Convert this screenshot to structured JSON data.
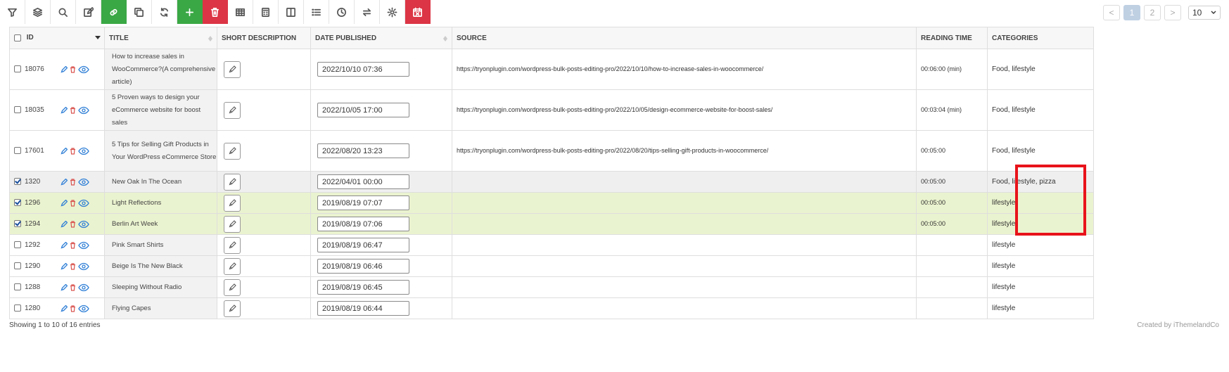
{
  "toolbar": {
    "buttons": [
      {
        "icon": "filter-icon"
      },
      {
        "icon": "layers-icon"
      },
      {
        "icon": "search-icon"
      },
      {
        "icon": "edit-icon"
      },
      {
        "icon": "link-icon",
        "color": "#3aa845"
      },
      {
        "icon": "copy-icon"
      },
      {
        "icon": "refresh-icon"
      },
      {
        "icon": "plus-icon",
        "color": "#3aa845"
      },
      {
        "icon": "trash-icon",
        "color": "#dc3545"
      },
      {
        "icon": "table-icon"
      },
      {
        "icon": "calculator-icon"
      },
      {
        "icon": "columns-icon"
      },
      {
        "icon": "list-icon"
      },
      {
        "icon": "clock-icon"
      },
      {
        "icon": "swap-icon"
      },
      {
        "icon": "gear-icon"
      },
      {
        "icon": "calendar-remove-icon",
        "color": "#dc3545"
      }
    ]
  },
  "pagination": {
    "prev": "<",
    "pages": [
      "1",
      "2"
    ],
    "active": "1",
    "next": ">",
    "per_page": "10"
  },
  "table": {
    "headers": {
      "id": "ID",
      "title": "TITLE",
      "short_description": "SHORT DESCRIPTION",
      "date_published": "DATE PUBLISHED",
      "source": "SOURCE",
      "reading_time": "READING TIME",
      "categories": "CATEGORIES"
    },
    "rows": [
      {
        "id": "18076",
        "checked": false,
        "title": "How to increase sales in WooCommerce?(A comprehensive article)",
        "date": "2022/10/10 07:36",
        "source": "https://tryonplugin.com/wordpress-bulk-posts-editing-pro/2022/10/10/how-to-increase-sales-in-woocommerce/",
        "reading_time": "00:06:00 (min)",
        "categories": "Food, lifestyle"
      },
      {
        "id": "18035",
        "checked": false,
        "title": "5 Proven ways to design your eCommerce website for boost sales",
        "date": "2022/10/05 17:00",
        "source": "https://tryonplugin.com/wordpress-bulk-posts-editing-pro/2022/10/05/design-ecommerce-website-for-boost-sales/",
        "reading_time": "00:03:04 (min)",
        "categories": "Food, lifestyle"
      },
      {
        "id": "17601",
        "checked": false,
        "title": "5 Tips for Selling Gift Products in Your WordPress eCommerce Store",
        "date": "2022/08/20 13:23",
        "source": "https://tryonplugin.com/wordpress-bulk-posts-editing-pro/2022/08/20/tips-selling-gift-products-in-woocommerce/",
        "reading_time": "00:05:00",
        "categories": "Food, lifestyle"
      },
      {
        "id": "1320",
        "checked": true,
        "title": "New Oak In The Ocean",
        "date": "2022/04/01 00:00",
        "source": "",
        "reading_time": "00:05:00",
        "categories": "Food, lifestyle, pizza"
      },
      {
        "id": "1296",
        "checked": true,
        "title": "Light Reflections",
        "date": "2019/08/19 07:07",
        "source": "",
        "reading_time": "00:05:00",
        "categories": "lifestyle"
      },
      {
        "id": "1294",
        "checked": true,
        "title": "Berlin Art Week",
        "date": "2019/08/19 07:06",
        "source": "",
        "reading_time": "00:05:00",
        "categories": "lifestyle"
      },
      {
        "id": "1292",
        "checked": false,
        "title": "Pink Smart Shirts",
        "date": "2019/08/19 06:47",
        "source": "",
        "reading_time": "",
        "categories": "lifestyle"
      },
      {
        "id": "1290",
        "checked": false,
        "title": "Beige Is The New Black",
        "date": "2019/08/19 06:46",
        "source": "",
        "reading_time": "",
        "categories": "lifestyle"
      },
      {
        "id": "1288",
        "checked": false,
        "title": "Sleeping Without Radio",
        "date": "2019/08/19 06:45",
        "source": "",
        "reading_time": "",
        "categories": "lifestyle"
      },
      {
        "id": "1280",
        "checked": false,
        "title": "Flying Capes",
        "date": "2019/08/19 06:44",
        "source": "",
        "reading_time": "",
        "categories": "lifestyle"
      }
    ]
  },
  "footer": {
    "entries": "Showing 1 to 10 of 16 entries",
    "credit": "Created by iThemelandCo"
  },
  "colors": {
    "green": "#3aa845",
    "red": "#dc3545",
    "highlight": "#e8131a",
    "selected_green": "#eaf3cf",
    "selected_grey": "#efefef"
  }
}
